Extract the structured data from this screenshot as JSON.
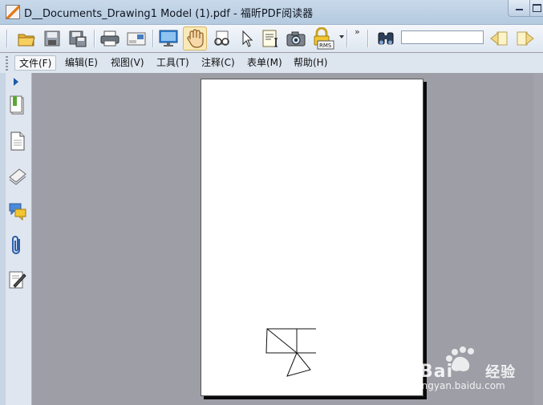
{
  "window": {
    "title": "D__Documents_Drawing1 Model (1).pdf - 福昕PDF阅读器"
  },
  "toolbar": {
    "buttons": [
      "open-folder-icon",
      "save-icon",
      "save-as-icon",
      "print-icon",
      "email-icon",
      "fullscreen-icon",
      "hand-tool-icon",
      "zoom-glasses-icon",
      "select-arrow-icon",
      "text-select-icon",
      "snapshot-camera-icon",
      "rms-lock-icon"
    ],
    "rms_label": "RMS",
    "overflow": "»",
    "search_value": ""
  },
  "menu": {
    "items": [
      "文件(F)",
      "编辑(E)",
      "视图(V)",
      "工具(T)",
      "注释(C)",
      "表单(M)",
      "帮助(H)"
    ]
  },
  "sidebar": {
    "icons": [
      "bookmarks-icon",
      "pages-icon",
      "layers-icon",
      "comments-icon",
      "attachments-icon",
      "signatures-icon"
    ]
  },
  "watermark": {
    "brand": "Bai",
    "brand_cn": "经验",
    "url": "jingyan.baidu.com"
  },
  "colors": {
    "titlebar": "#c9d9ea",
    "workspace": "#9d9ea6",
    "active_tool": "#f9e9b8"
  }
}
